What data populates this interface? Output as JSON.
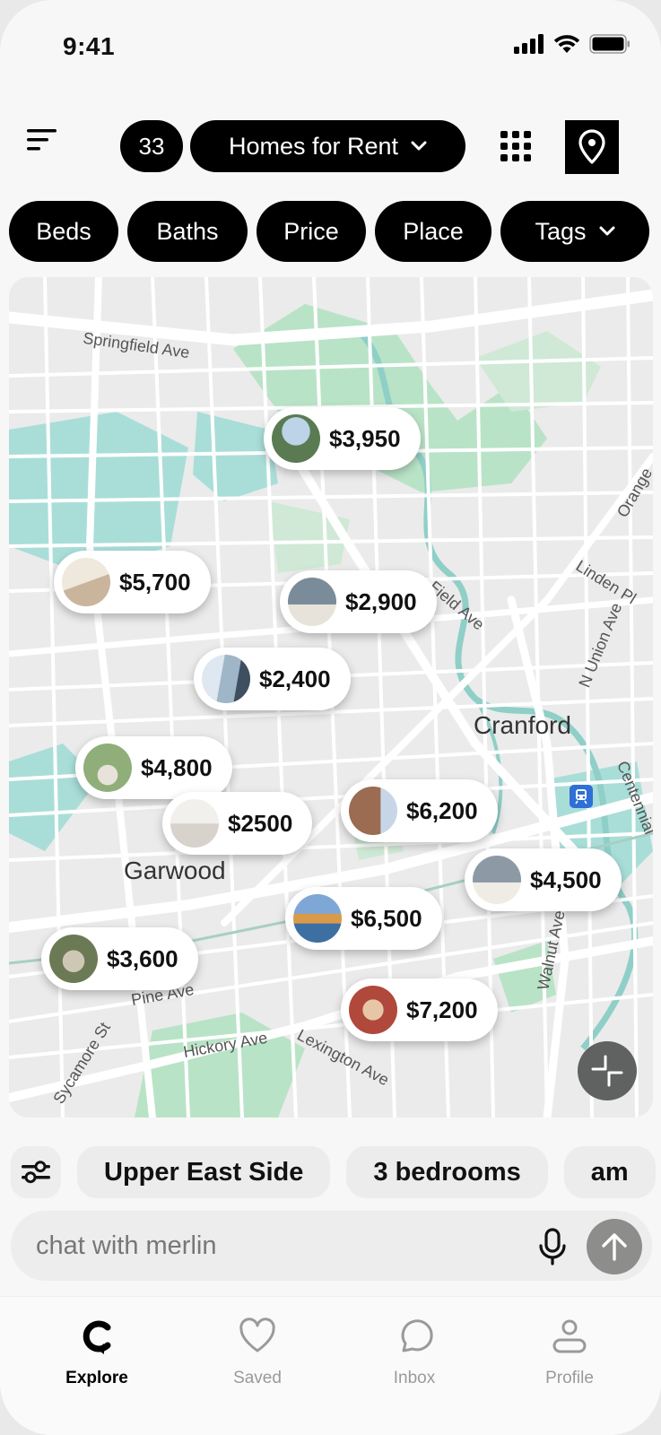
{
  "status_bar": {
    "time": "9:41"
  },
  "header": {
    "menu_icon": "menu-icon",
    "count": "33",
    "mode_label": "Homes for Rent",
    "grid_icon": "grid-icon",
    "map_pin_icon": "map-pin-icon"
  },
  "filters": [
    {
      "label": "Beds"
    },
    {
      "label": "Baths"
    },
    {
      "label": "Price"
    },
    {
      "label": "Place"
    },
    {
      "label": "Tags"
    }
  ],
  "map": {
    "places": [
      {
        "label": "Cranford"
      },
      {
        "label": "Garwood"
      }
    ],
    "streets": [
      "Springfield Ave",
      "Linden Pl",
      "N Union Ave",
      "Centennial",
      "Orange",
      "Pine Ave",
      "Hickory Ave",
      "Lexington Ave",
      "Sycamore St",
      "Walnut Ave",
      "Field Ave"
    ],
    "listings": [
      {
        "price": "$3,950",
        "thumb_color": "#5a7b52"
      },
      {
        "price": "$5,700",
        "thumb_color": "#c9b49c"
      },
      {
        "price": "$2,900",
        "thumb_color": "#7a8b99"
      },
      {
        "price": "$2,400",
        "thumb_color": "#9fb5c8"
      },
      {
        "price": "$4,800",
        "thumb_color": "#8fae7a"
      },
      {
        "price": "$2500",
        "thumb_color": "#d7d3cc"
      },
      {
        "price": "$6,200",
        "thumb_color": "#9b6b52"
      },
      {
        "price": "$4,500",
        "thumb_color": "#8d9aa6"
      },
      {
        "price": "$6,500",
        "thumb_color": "#d99a4a"
      },
      {
        "price": "$3,600",
        "thumb_color": "#6b7a55"
      },
      {
        "price": "$7,200",
        "thumb_color": "#b0483c"
      }
    ]
  },
  "suggestions": [
    "Upper East Side",
    "3 bedrooms",
    "am"
  ],
  "chat": {
    "placeholder": "chat with merlin"
  },
  "nav": [
    {
      "label": "Explore",
      "icon": "explore-icon",
      "active": true
    },
    {
      "label": "Saved",
      "icon": "heart-icon",
      "active": false
    },
    {
      "label": "Inbox",
      "icon": "chat-bubble-icon",
      "active": false
    },
    {
      "label": "Profile",
      "icon": "profile-icon",
      "active": false
    }
  ]
}
